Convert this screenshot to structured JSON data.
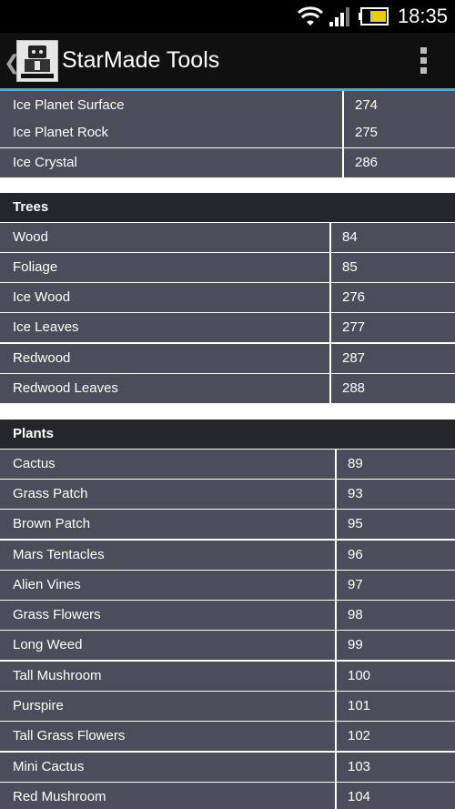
{
  "status_bar": {
    "time": "18:35",
    "icons": [
      "wifi-icon",
      "signal-icon",
      "battery-icon"
    ]
  },
  "action_bar": {
    "title": "StarMade Tools",
    "logo_text": "StarMade tools"
  },
  "sections": [
    {
      "id": "ice",
      "title": "",
      "rows": [
        {
          "name": "Ice Planet Surface",
          "id": "274"
        },
        {
          "name": "Ice Planet Rock",
          "id": "275"
        },
        {
          "name": "Ice Crystal",
          "id": "286"
        }
      ]
    },
    {
      "id": "trees",
      "title": "Trees",
      "rows": [
        {
          "name": "Wood",
          "id": "84"
        },
        {
          "name": "Foliage",
          "id": "85"
        },
        {
          "name": "Ice Wood",
          "id": "276"
        },
        {
          "name": "Ice Leaves",
          "id": "277"
        },
        {
          "name": "Redwood",
          "id": "287"
        },
        {
          "name": "Redwood Leaves",
          "id": "288"
        }
      ]
    },
    {
      "id": "plants",
      "title": "Plants",
      "rows": [
        {
          "name": "Cactus",
          "id": "89"
        },
        {
          "name": "Grass Patch",
          "id": "93"
        },
        {
          "name": "Brown Patch",
          "id": "95"
        },
        {
          "name": "Mars Tentacles",
          "id": "96"
        },
        {
          "name": "Alien Vines",
          "id": "97"
        },
        {
          "name": "Grass Flowers",
          "id": "98"
        },
        {
          "name": "Long Weed",
          "id": "99"
        },
        {
          "name": "Tall Mushroom",
          "id": "100"
        },
        {
          "name": "Purspire",
          "id": "101"
        },
        {
          "name": "Tall Grass Flowers",
          "id": "102"
        },
        {
          "name": "Mini Cactus",
          "id": "103"
        },
        {
          "name": "Red Mushroom",
          "id": "104"
        }
      ]
    }
  ],
  "colors": {
    "accent": "#33b5e5",
    "row_bg": "#4b4e5a",
    "header_bg": "#24262c",
    "action_bar_bg": "#101010"
  }
}
